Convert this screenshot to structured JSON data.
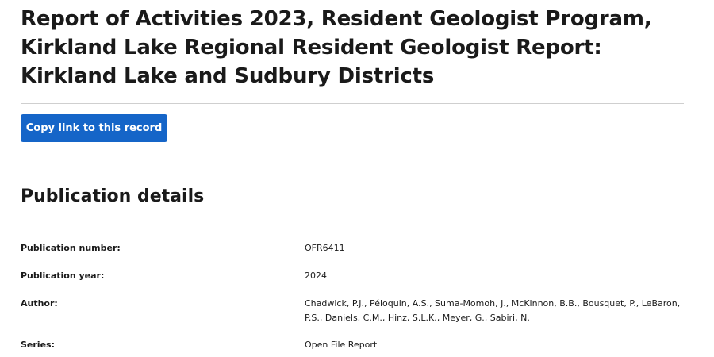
{
  "record": {
    "title": "Report of Activities 2023, Resident Geologist Program, Kirkland Lake Regional Resident Geologist Report: Kirkland Lake and Sudbury Districts",
    "copy_link_label": "Copy link to this record"
  },
  "publication_details": {
    "heading": "Publication details",
    "rows": [
      {
        "label": "Publication number:",
        "value": "OFR6411"
      },
      {
        "label": "Publication year:",
        "value": "2024"
      },
      {
        "label": "Author:",
        "value": "Chadwick, P.J., Péloquin, A.S., Suma-Momoh, J., McKinnon, B.B., Bousquet, P., LeBaron, P.S., Daniels, C.M., Hinz, S.L.K., Meyer, G., Sabiri, N."
      },
      {
        "label": "Series:",
        "value": "Open File Report"
      }
    ]
  }
}
